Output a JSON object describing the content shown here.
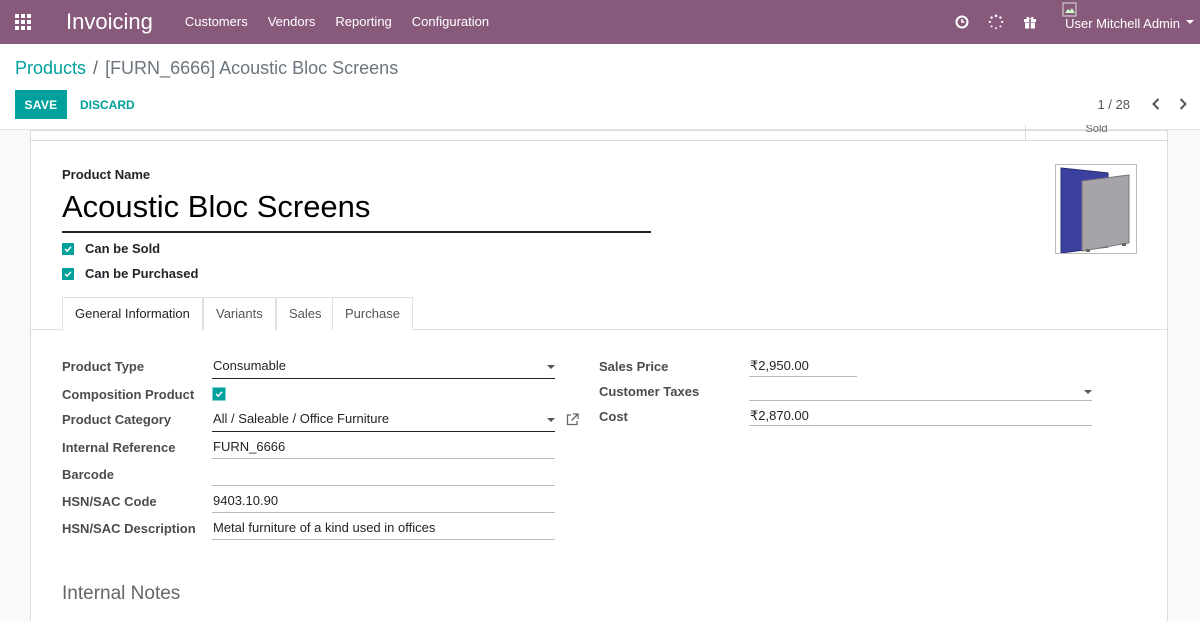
{
  "navbar": {
    "app_name": "Invoicing",
    "menu": [
      "Customers",
      "Vendors",
      "Reporting",
      "Configuration"
    ],
    "icons": [
      "clock-icon",
      "activity-spinner-icon",
      "gift-icon"
    ],
    "user_name": "User Mitchell Admin",
    "brand_color": "#875a7b"
  },
  "control_panel": {
    "breadcrumb_parent": "Products",
    "breadcrumb_separator": "/",
    "breadcrumb_current": "[FURN_6666] Acoustic Bloc Screens",
    "save_label": "SAVE",
    "discard_label": "DISCARD",
    "pager": "1 / 28",
    "accent_color": "#00a09d"
  },
  "button_box": {
    "stat_label": "Sold"
  },
  "form": {
    "product_name_label": "Product Name",
    "product_name": "Acoustic Bloc Screens",
    "can_be_sold_label": "Can be Sold",
    "can_be_sold": true,
    "can_be_purchased_label": "Can be Purchased",
    "can_be_purchased": true
  },
  "tabs": [
    "General Information",
    "Variants",
    "Sales",
    "Purchase"
  ],
  "active_tab": "General Information",
  "general": {
    "left": {
      "product_type_label": "Product Type",
      "product_type": "Consumable",
      "composition_label": "Composition Product",
      "composition": true,
      "category_label": "Product Category",
      "category": "All / Saleable / Office Furniture",
      "internal_ref_label": "Internal Reference",
      "internal_ref": "FURN_6666",
      "barcode_label": "Barcode",
      "barcode": "",
      "hsn_code_label": "HSN/SAC Code",
      "hsn_code": "9403.10.90",
      "hsn_desc_label": "HSN/SAC Description",
      "hsn_desc": "Metal furniture of a kind used in offices"
    },
    "right": {
      "sales_price_label": "Sales Price",
      "sales_price": "₹2,950.00",
      "customer_taxes_label": "Customer Taxes",
      "customer_taxes": "",
      "cost_label": "Cost",
      "cost": "₹2,870.00"
    }
  },
  "internal_notes_title": "Internal Notes"
}
